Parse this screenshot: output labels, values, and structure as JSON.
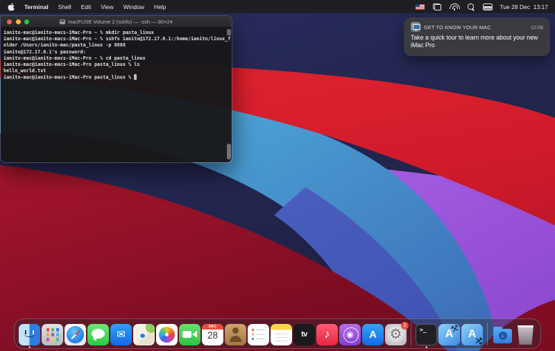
{
  "menu_bar": {
    "app_name": "Terminal",
    "menus": [
      "Shell",
      "Edit",
      "View",
      "Window",
      "Help"
    ],
    "status_icons": [
      "us-flag",
      "displays",
      "wifi",
      "spotlight-search",
      "control-center"
    ],
    "clock": "Tue 28 Dec  13:17"
  },
  "terminal_window": {
    "title": "macFUSE Volume 2 (sshfs) — -zsh — 80×24",
    "lines": [
      "ianito-mac@ianito-macs-iMac-Pro ~ % mkdir pasta_linux",
      "ianito-mac@ianito-macs-iMac-Pro ~ % sshfs ianito@172.17.0.1:/home/ianito/linux_f",
      "older /Users/ianito-mac/pasta_linux -p 8888",
      "ianito@172.17.0.1's password:",
      "ianito-mac@ianito-macs-iMac-Pro ~ % cd pasta_linux",
      "ianito-mac@ianito-macs-iMac-Pro pasta_linux % ls",
      "hello_world.txt"
    ],
    "current_line": "ianito-mac@ianito-macs-iMac-Pro pasta_linux % "
  },
  "notification": {
    "title": "GET TO KNOW YOUR MAC",
    "time": "12:08",
    "body": "Take a quick tour to learn more about your new iMac Pro"
  },
  "dock": {
    "items": [
      {
        "id": "finder",
        "label": "Finder",
        "running": true
      },
      {
        "id": "launchpad",
        "label": "Launchpad"
      },
      {
        "id": "safari",
        "label": "Safari"
      },
      {
        "id": "messages",
        "label": "Messages"
      },
      {
        "id": "mail",
        "label": "Mail",
        "glyph": "✉"
      },
      {
        "id": "maps",
        "label": "Maps"
      },
      {
        "id": "photos",
        "label": "Photos"
      },
      {
        "id": "facetime",
        "label": "FaceTime"
      },
      {
        "id": "calendar",
        "label": "Calendar",
        "month": "DEC",
        "day": "28"
      },
      {
        "id": "contacts",
        "label": "Contacts"
      },
      {
        "id": "reminders",
        "label": "Reminders"
      },
      {
        "id": "notes",
        "label": "Notes"
      },
      {
        "id": "tv",
        "label": "TV",
        "glyph": "tv"
      },
      {
        "id": "music",
        "label": "Music",
        "glyph": "♪"
      },
      {
        "id": "podcasts",
        "label": "Podcasts",
        "glyph": "◉"
      },
      {
        "id": "appstore",
        "label": "App Store",
        "glyph": "A"
      },
      {
        "id": "syspref",
        "label": "System Preferences",
        "glyph": "⚙",
        "badge": "2"
      },
      {
        "id": "separator"
      },
      {
        "id": "terminal",
        "label": "Terminal",
        "glyph": ">_",
        "running": true
      },
      {
        "id": "devtool",
        "label": "Xcode",
        "glyph": "A"
      },
      {
        "id": "devtool2",
        "label": "Developer Tool",
        "glyph": "A"
      },
      {
        "id": "separator"
      },
      {
        "id": "downloads",
        "label": "Downloads",
        "glyph": "↓"
      },
      {
        "id": "trash",
        "label": "Trash"
      }
    ]
  },
  "colors": {
    "traffic_red": "#ff5f57",
    "traffic_yellow": "#febc2e",
    "traffic_green": "#28c840",
    "badge_red": "#ec4d3d"
  }
}
